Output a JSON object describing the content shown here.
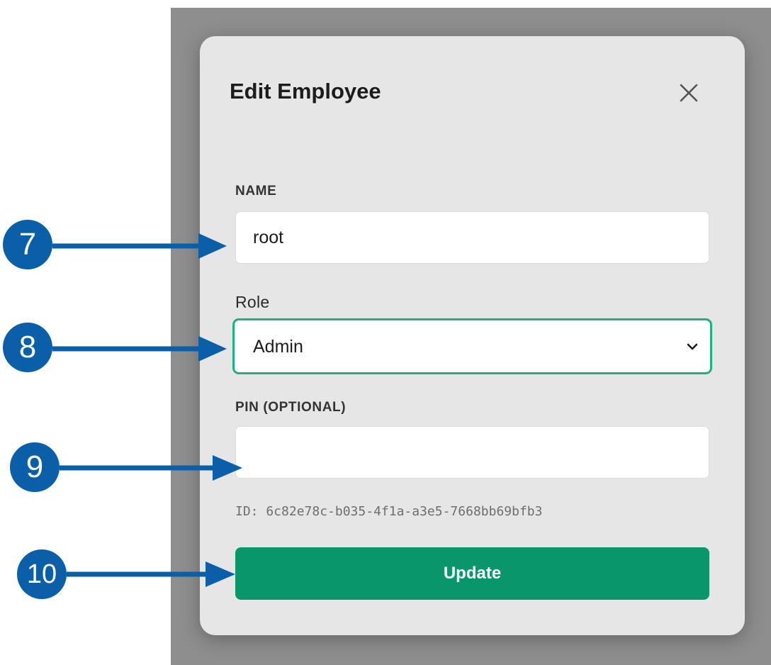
{
  "dialog": {
    "title": "Edit Employee",
    "close_icon": "close-icon"
  },
  "fields": {
    "name": {
      "label": "NAME",
      "value": "root"
    },
    "role": {
      "label": "Role",
      "selected": "Admin"
    },
    "pin": {
      "label": "PIN (OPTIONAL)",
      "value": ""
    }
  },
  "id_text": "ID: 6c82e78c-b035-4f1a-a3e5-7668bb69bfb3",
  "submit_label": "Update",
  "callouts": [
    "7",
    "8",
    "9",
    "10"
  ],
  "colors": {
    "primary": "#08966a",
    "focus_border": "#1fb07f",
    "callout": "#0a5fa8",
    "backdrop": "#8e8e8e",
    "modal": "#e6e6e6"
  }
}
